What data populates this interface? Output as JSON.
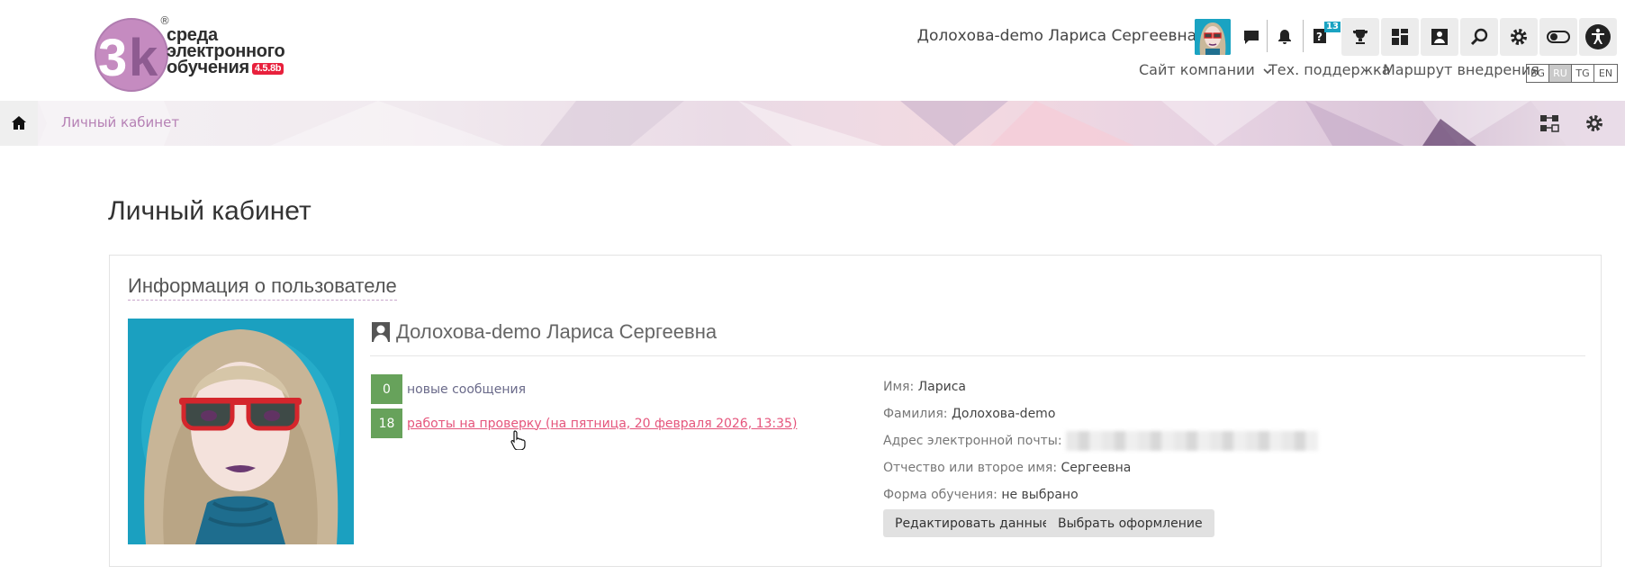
{
  "header": {
    "logo": {
      "line1": "среда",
      "line2": "электронного",
      "line3": "обучения",
      "version": "4.5.8b",
      "reg": "®"
    },
    "user_name": "Долохова-demo Лариса Сергеевна",
    "icons": [
      "messages-icon",
      "bell-icon",
      "help-icon",
      "trophy-icon",
      "dashboard-icon",
      "portfolio-icon",
      "search-icon",
      "gear-icon",
      "toggle-icon",
      "accessibility-icon"
    ],
    "help_badge": "13",
    "nav": {
      "company_site": "Сайт компании",
      "support": "Тех. поддержка",
      "roadmap": "Маршрут внедрения"
    },
    "languages": [
      {
        "code": "BG",
        "active": false
      },
      {
        "code": "RU",
        "active": true
      },
      {
        "code": "TG",
        "active": false
      },
      {
        "code": "EN",
        "active": false
      }
    ]
  },
  "breadcrumb": {
    "items": [
      "Личный кабинет"
    ]
  },
  "page": {
    "title": "Личный кабинет"
  },
  "user_info": {
    "section_title": "Информация о пользователе",
    "full_name": "Долохова-demo Лариса Сергеевна",
    "stats": [
      {
        "count": "0",
        "label": "новые сообщения",
        "link": false
      },
      {
        "count": "18",
        "label": "работы на проверку (на пятница, 20 февраля 2026, 13:35)",
        "link": true
      }
    ],
    "fields": [
      {
        "label": "Имя:",
        "value": "Лариса"
      },
      {
        "label": "Фамилия:",
        "value": "Долохова-demo"
      },
      {
        "label": "Адрес электронной почты:",
        "value": ""
      },
      {
        "label": "Отчество или второе имя:",
        "value": "Сергеевна"
      },
      {
        "label": "Форма обучения:",
        "value": "не выбрано"
      }
    ],
    "buttons": {
      "edit": "Редактировать данные",
      "theme": "Выбрать оформление"
    }
  },
  "colors": {
    "accent_pink": "#e5557c",
    "stat_green": "#67a25b",
    "crumb_purple": "#b681b5",
    "photo_bg": "#1ba0c0"
  }
}
